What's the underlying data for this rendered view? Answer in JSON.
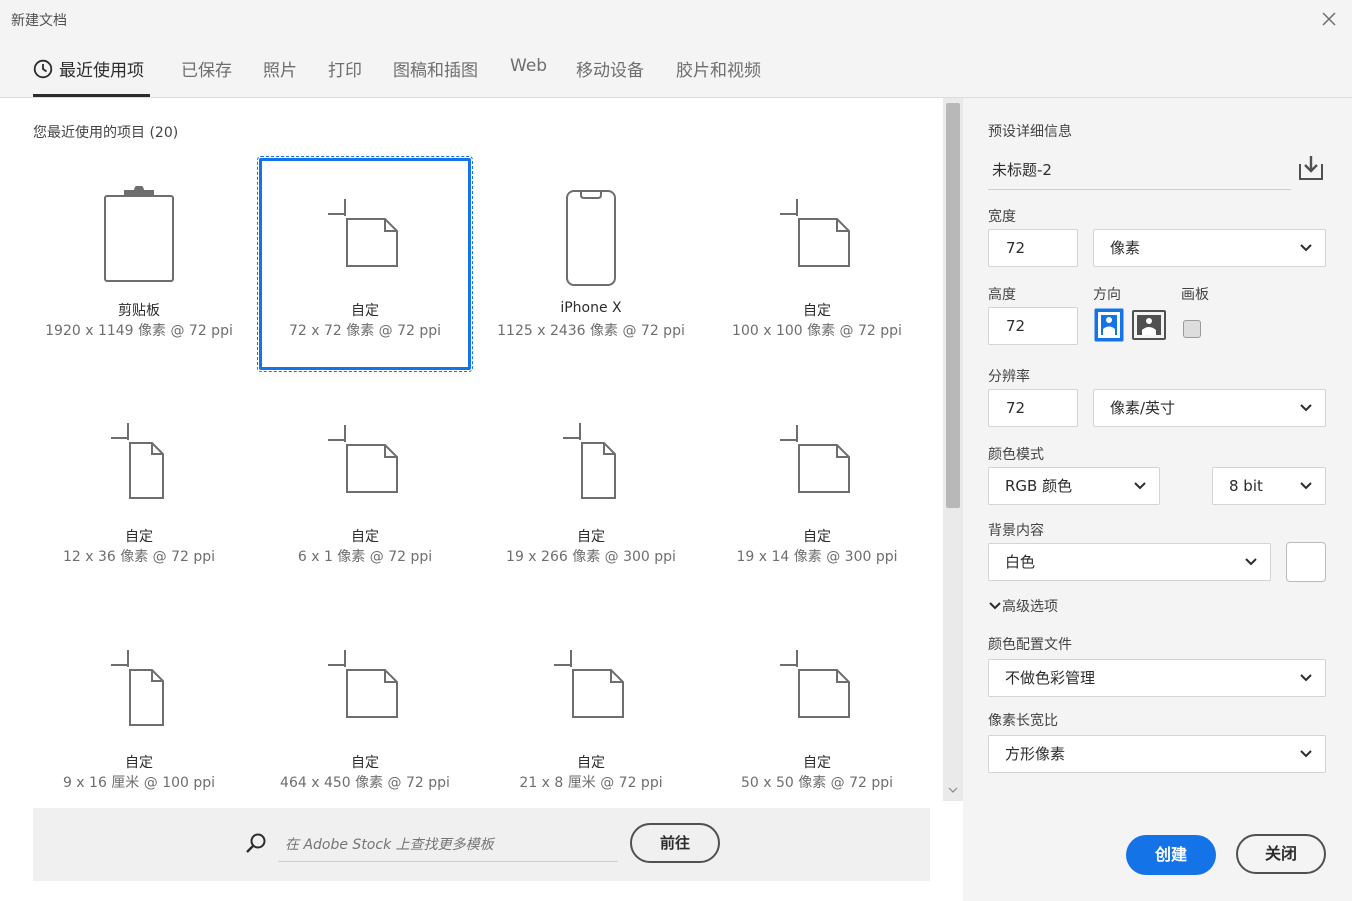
{
  "window": {
    "title": "新建文档"
  },
  "tabs": [
    {
      "label": "最近使用项"
    },
    {
      "label": "已保存"
    },
    {
      "label": "照片"
    },
    {
      "label": "打印"
    },
    {
      "label": "图稿和插图"
    },
    {
      "label": "Web"
    },
    {
      "label": "移动设备"
    },
    {
      "label": "胶片和视频"
    }
  ],
  "recent": {
    "title": "您最近使用的项目 (20)",
    "items": [
      {
        "name": "剪贴板",
        "dims": "1920 x 1149 像素 @ 72 ppi",
        "icon": "clipboard-icon"
      },
      {
        "name": "自定",
        "dims": "72 x 72 像素 @ 72 ppi",
        "icon": "document-icon",
        "selected": true
      },
      {
        "name": "iPhone X",
        "dims": "1125 x 2436 像素 @ 72 ppi",
        "icon": "phone-icon"
      },
      {
        "name": "自定",
        "dims": "100 x 100 像素 @ 72 ppi",
        "icon": "document-icon"
      },
      {
        "name": "自定",
        "dims": "12 x 36 像素 @ 72 ppi",
        "icon": "document-icon"
      },
      {
        "name": "自定",
        "dims": "6 x 1 像素 @ 72 ppi",
        "icon": "document-icon"
      },
      {
        "name": "自定",
        "dims": "19 x 266 像素 @ 300 ppi",
        "icon": "document-icon"
      },
      {
        "name": "自定",
        "dims": "19 x 14 像素 @ 300 ppi",
        "icon": "document-icon"
      },
      {
        "name": "自定",
        "dims": "9 x 16 厘米 @ 100 ppi",
        "icon": "document-icon"
      },
      {
        "name": "自定",
        "dims": "464 x 450 像素 @ 72 ppi",
        "icon": "document-icon"
      },
      {
        "name": "自定",
        "dims": "21 x 8 厘米 @ 72 ppi",
        "icon": "document-icon"
      },
      {
        "name": "自定",
        "dims": "50 x 50 像素 @ 72 ppi",
        "icon": "document-icon"
      }
    ]
  },
  "stock": {
    "placeholder": "在 Adobe Stock 上查找更多模板",
    "go_label": "前往"
  },
  "details": {
    "title": "预设详细信息",
    "doc_name": "未标题-2",
    "width_label": "宽度",
    "width_value": "72",
    "width_unit": "像素",
    "height_label": "高度",
    "height_value": "72",
    "orientation_label": "方向",
    "artboard_label": "画板",
    "resolution_label": "分辨率",
    "resolution_value": "72",
    "resolution_unit": "像素/英寸",
    "color_mode_label": "颜色模式",
    "color_mode_value": "RGB 颜色",
    "bit_depth_value": "8 bit",
    "background_label": "背景内容",
    "background_value": "白色",
    "advanced_label": "高级选项",
    "color_profile_label": "颜色配置文件",
    "color_profile_value": "不做色彩管理",
    "pixel_aspect_label": "像素长宽比",
    "pixel_aspect_value": "方形像素"
  },
  "buttons": {
    "create": "创建",
    "close": "关闭"
  },
  "colors": {
    "accent": "#1473e6",
    "panel_bg": "#f4f4f4",
    "text": "#2c2c2c"
  }
}
